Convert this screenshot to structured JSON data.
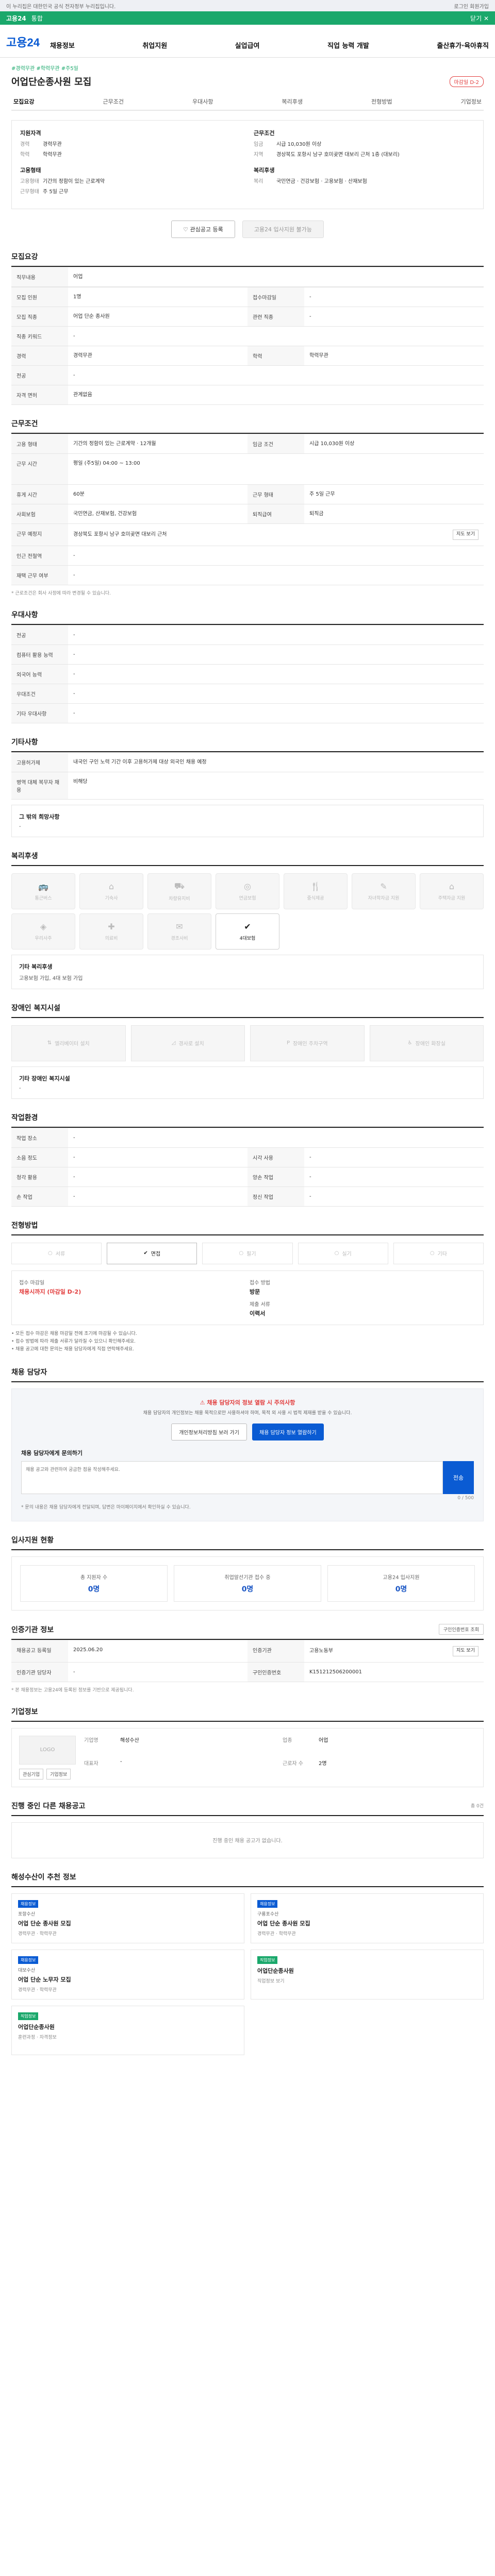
{
  "topbar": {
    "left": "이 누리집은 대한민국 공식 전자정부 누리집입니다.",
    "right": "로그인  회원가입"
  },
  "greenbar": {
    "label": "고용24",
    "text": "통합",
    "close": "닫기 ✕"
  },
  "header": {
    "logo": "고용24",
    "nav": [
      "채용정보",
      "취업지원",
      "실업급여",
      "직업 능력 개발",
      "출산휴가·육아휴직"
    ]
  },
  "job": {
    "hashtags": "#경력무관 #학력무관 #주5일",
    "title": "어업단순종사원 모집",
    "badge": "마감일 D-2",
    "tabs": [
      "모집요강",
      "근무조건",
      "우대사항",
      "복리후생",
      "전형방법",
      "기업정보"
    ]
  },
  "summary": {
    "left_h": "지원자격",
    "left_rows": [
      {
        "k": "경력",
        "v": "경력무관"
      },
      {
        "k": "학력",
        "v": "학력무관"
      }
    ],
    "left_h2": "고용형태",
    "left_rows2": [
      {
        "k": "고용형태",
        "v": "기간의 정함이 있는 근로계약"
      },
      {
        "k": "근무형태",
        "v": "주 5일 근무"
      }
    ],
    "right_h": "근무조건",
    "right_rows": [
      {
        "k": "임금",
        "v": "시급 10,030원 이상"
      },
      {
        "k": "지역",
        "v": "경상북도 포항시 남구 호미곶면 대보리 근처 1층 (대보리)"
      }
    ],
    "right_h2": "복리후생",
    "right_rows2": [
      {
        "k": "복리",
        "v": "국민연금 · 건강보험 · 고용보험 · 산재보험"
      }
    ]
  },
  "actions": {
    "save": "관심공고 등록",
    "apply": "고용24 입사지원 불가능"
  },
  "recruit": {
    "title": "모집요강",
    "duty_h": "직무내용",
    "duty_v": "어업",
    "rows": [
      {
        "k1": "모집 인원",
        "v1": "1명",
        "k2": "접수마감일",
        "v2": "-"
      },
      {
        "k1": "모집 직종",
        "v1": "어업 단순 종사원",
        "k2": "관련 직종",
        "v2": "-"
      },
      {
        "k1": "직종 키워드",
        "v1": "-",
        "k2": "",
        "v2": ""
      },
      {
        "k1": "경력",
        "v1": "경력무관",
        "k2": "학력",
        "v2": "학력무관"
      },
      {
        "k1": "전공",
        "v1": "-",
        "k2": "",
        "v2": ""
      },
      {
        "k1": "자격 면허",
        "v1": "관계없음",
        "k2": "",
        "v2": ""
      }
    ]
  },
  "conditions": {
    "title": "근무조건",
    "rows": [
      {
        "k1": "고용 형태",
        "v1": "기간의 정함이 있는 근로계약 · 12개월",
        "k2": "임금 조건",
        "v2": "시급 10,030원 이상"
      },
      {
        "k1": "근무 시간",
        "v1": "평일 (주5일) 04:00 ~ 13:00",
        "k2": "",
        "v2": ""
      },
      {
        "k1": "휴게 시간",
        "v1": "60분",
        "k2": "근무 형태",
        "v2": "주 5일 근무"
      },
      {
        "k1": "사회보험",
        "v1": "국민연금, 산재보험, 건강보험",
        "k2": "퇴직급여",
        "v2": "퇴직금"
      },
      {
        "k1": "근무 예정지",
        "v1": "경상북도 포항시 남구 호미곶면 대보리 근처",
        "k2": "",
        "v2": ""
      },
      {
        "k1": "인근 전철역",
        "v1": "-",
        "k2": "",
        "v2": ""
      },
      {
        "k1": "재택 근무 여부",
        "v1": "-",
        "k2": "",
        "v2": ""
      }
    ],
    "map_btn": "지도 보기",
    "note": "* 근로조건은 회사 사정에 따라 변경될 수 있습니다."
  },
  "preference": {
    "title": "우대사항",
    "rows": [
      {
        "k": "전공",
        "v": "-"
      },
      {
        "k": "컴퓨터 활용 능력",
        "v": "-"
      },
      {
        "k": "외국어 능력",
        "v": "-"
      },
      {
        "k": "우대조건",
        "v": "-"
      },
      {
        "k": "기타 우대사항",
        "v": "-"
      }
    ]
  },
  "other": {
    "title": "기타사항",
    "rows": [
      {
        "k": "고용허가제",
        "v": "내국인 구인 노력 기간 이후 고용허가제 대상 외국인 채용 예정"
      },
      {
        "k": "병역 대체 복무자 채용",
        "v": "비해당"
      }
    ],
    "extra_h": "그 밖의 희망사항",
    "extra_v": "-"
  },
  "welfare": {
    "title": "복리후생",
    "items": [
      {
        "label": "통근버스",
        "active": false
      },
      {
        "label": "기숙사",
        "active": false
      },
      {
        "label": "차량유지비",
        "active": false
      },
      {
        "label": "연금보험",
        "active": false
      },
      {
        "label": "중식제공",
        "active": false
      },
      {
        "label": "자녀학자금 지원",
        "active": false
      },
      {
        "label": "주택자금 지원",
        "active": false
      },
      {
        "label": "우리사주",
        "active": false
      },
      {
        "label": "의료비",
        "active": false
      },
      {
        "label": "경조사비",
        "active": false
      },
      {
        "label": "4대보험",
        "active": true
      }
    ],
    "extra_h": "기타 복리후생",
    "extra_v": "고용보험 가입, 4대 보험 가입"
  },
  "disability": {
    "title": "장애인 복지시설",
    "items": [
      "엘리베이터 설치",
      "경사로 설치",
      "장애인 주차구역",
      "장애인 화장실"
    ],
    "extra_h": "기타 장애인 복지시설",
    "extra_v": "-"
  },
  "workenv": {
    "title": "작업환경",
    "rows": [
      {
        "k1": "작업 장소",
        "v1": "-",
        "k2": "",
        "v2": ""
      },
      {
        "k1": "소음 정도",
        "v1": "-",
        "k2": "시각 사용",
        "v2": "-"
      },
      {
        "k1": "청각 활용",
        "v1": "-",
        "k2": "양손 작업",
        "v2": "-"
      },
      {
        "k1": "손 작업",
        "v1": "-",
        "k2": "정신 작업",
        "v2": "-"
      }
    ]
  },
  "selection": {
    "title": "전형방법",
    "steps": [
      {
        "label": "서류",
        "active": false
      },
      {
        "label": "면접",
        "active": true
      },
      {
        "label": "필기",
        "active": false
      },
      {
        "label": "실기",
        "active": false
      },
      {
        "label": "기타",
        "active": false
      }
    ],
    "apply": {
      "k1": "접수 마감일",
      "v1": "채용시까지 (마감일 D-2)",
      "k2": "접수 방법",
      "v2": "방문",
      "k3": "제출 서류",
      "v3": "이력서"
    },
    "bullets": [
      "모든 접수 마감은 채용 마감일 전에 조기에 마감될 수 있습니다.",
      "접수 방법에 따라 제출 서류가 달라질 수 있으니 확인해주세요.",
      "채용 공고에 대한 문의는 채용 담당자에게 직접 연락해주세요."
    ]
  },
  "manager": {
    "title": "채용 담당자",
    "alert": "채용 담당자의 정보 열람 시 주의사항",
    "desc": "채용 담당자의 개인정보는 채용 목적으로만 사용하셔야 하며, 목적 외 사용 시 법적 제재를 받을 수 있습니다.",
    "btn1": "개인정보처리방침 보러 가기",
    "btn2": "채용 담당자 정보 열람하기",
    "qa_title": "채용 담당자에게 문의하기",
    "qa_placeholder": "채용 공고와 관련하여 궁금한 점을 작성해주세요.",
    "qa_btn": "전송",
    "qa_count": "0 / 500",
    "qa_notes": "* 문의 내용은 채용 담당자에게 전달되며, 답변은 마이페이지에서 확인하실 수 있습니다."
  },
  "stats": {
    "title": "입사지원 현황",
    "items": [
      {
        "k": "총 지원자 수",
        "v": "0명"
      },
      {
        "k": "취업알선기관 접수 중",
        "v": "0명"
      },
      {
        "k": "고용24 입사지원",
        "v": "0명"
      }
    ]
  },
  "jobinfo": {
    "title": "인증기관 정보",
    "btn": "구인인증번호 조회",
    "rows": [
      {
        "k1": "채용공고 등록일",
        "v1": "2025.06.20",
        "k2": "인증기관",
        "v2": "고용노동부"
      },
      {
        "k1": "인증기관 담당자",
        "v1": "-",
        "k2": "구인인증번호",
        "v2": "K151212506200001"
      }
    ],
    "map_btn": "지도 보기",
    "note": "* 본 채용정보는 고용24에 등록된 정보를 기반으로 제공됩니다."
  },
  "company": {
    "title": "기업정보",
    "logo": "LOGO",
    "rows": [
      {
        "k": "기업명",
        "v": "해성수산"
      },
      {
        "k": "업종",
        "v": "어업"
      },
      {
        "k": "대표자",
        "v": "-"
      },
      {
        "k": "근로자 수",
        "v": "2명"
      }
    ],
    "btns": [
      "관심기업",
      "기업정보"
    ]
  },
  "ongoing": {
    "title": "진행 중인 다른 채용공고",
    "note": "총 0건",
    "empty": "진행 중인 채용 공고가 없습니다."
  },
  "recommend": {
    "title": "해성수산이 추천 정보",
    "items": [
      {
        "badges": [
          "채용정보"
        ],
        "co": "포항수산",
        "title": "어업 단순 종사원 모집",
        "meta": "경력무관 · 학력무관"
      },
      {
        "badges": [
          "채용정보"
        ],
        "co": "구룡포수산",
        "title": "어업 단순 종사원 모집",
        "meta": "경력무관 · 학력무관"
      },
      {
        "badges": [
          "채용정보"
        ],
        "co": "대보수산",
        "title": "어업 단순 노무자 모집",
        "meta": "경력무관 · 학력무관"
      },
      {
        "badges": [
          "직업정보"
        ],
        "co": "",
        "title": "어업단순종사원",
        "meta": "직업정보 보기"
      },
      {
        "badges": [
          "직업정보"
        ],
        "co": "",
        "title": "어업단순종사원",
        "meta": "훈련과정 · 자격정보"
      }
    ]
  }
}
